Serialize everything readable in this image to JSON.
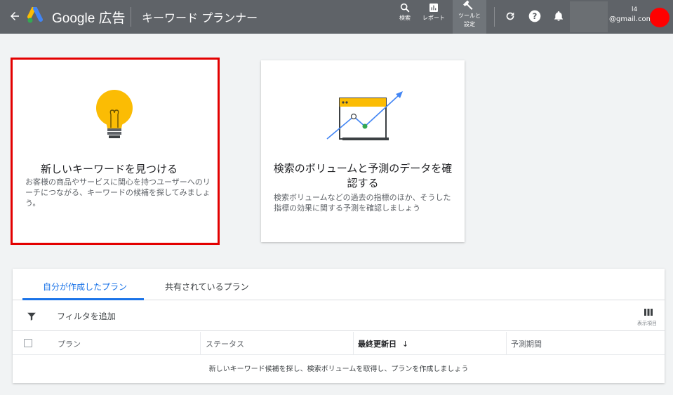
{
  "topbar": {
    "brand": "Google 広告",
    "app_title": "キーワード プランナー",
    "tools": [
      {
        "icon": "search-icon",
        "label": "検索"
      },
      {
        "icon": "reports-icon",
        "label": "レポート"
      },
      {
        "icon": "wrench-icon",
        "label_line1": "ツールと",
        "label_line2": "設定"
      }
    ],
    "icons": [
      "refresh-icon",
      "help-icon",
      "bell-icon"
    ],
    "account_number": "l4",
    "account_email": "@gmail.com",
    "avatar_color": "#ff0000"
  },
  "cards": [
    {
      "icon": "lightbulb-icon",
      "title": "新しいキーワードを見つける",
      "description": "お客様の商品やサービスに関心を持つユーザーへのリーチにつながる、キーワードの候補を探してみましょう。"
    },
    {
      "icon": "forecast-chart-icon",
      "title": "検索のボリュームと予測のデータを確認する",
      "description": "検索ボリュームなどの過去の指標のほか、そうした指標の効果に関する予測を確認しましょう"
    }
  ],
  "plans": {
    "tabs": [
      "自分が作成したプラン",
      "共有されているプラン"
    ],
    "filter_label": "フィルタを追加",
    "columns_label": "表示項目",
    "columns": [
      "プラン",
      "ステータス",
      "最終更新日",
      "予測期間"
    ],
    "sort_indicator": "↓",
    "empty_message": "新しいキーワード候補を探し、検索ボリュームを取得し、プランを作成しましょう"
  },
  "colors": {
    "topbar": "#5f6368",
    "accent": "#1a73e8",
    "highlight_border": "#e30000",
    "bulb": "#fbbc04",
    "chart_dot": "#34a853",
    "chart_arrow": "#4285f4"
  }
}
